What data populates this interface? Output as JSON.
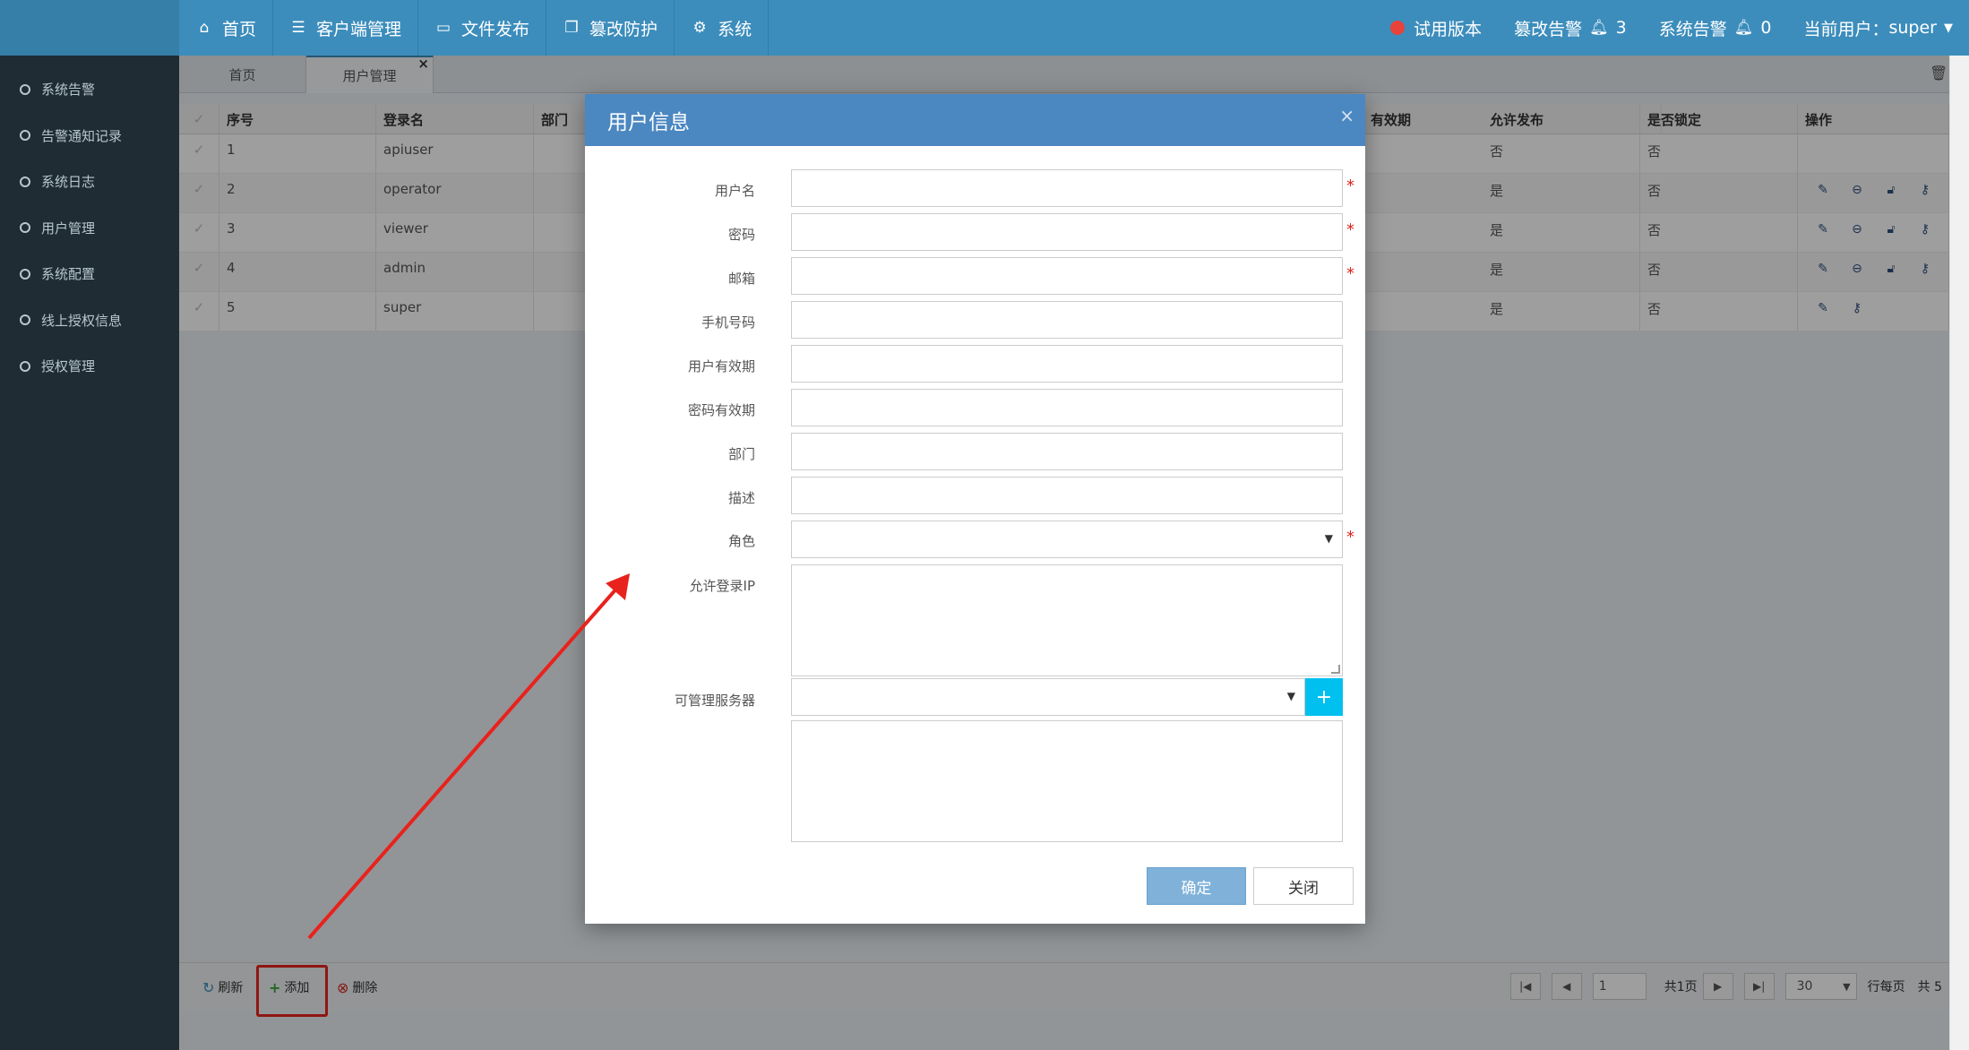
{
  "topbar": {
    "nav": [
      {
        "label": "首页",
        "icon": "home-icon"
      },
      {
        "label": "客户端管理",
        "icon": "server-icon"
      },
      {
        "label": "文件发布",
        "icon": "laptop-icon"
      },
      {
        "label": "篡改防护",
        "icon": "copy-icon"
      },
      {
        "label": "系统",
        "icon": "gears-icon"
      }
    ],
    "trial_label": "试用版本",
    "tamper_alert_label": "篡改告警",
    "tamper_alert_count": "3",
    "system_alert_label": "系统告警",
    "system_alert_count": "0",
    "current_user_label": "当前用户：",
    "current_user": "super"
  },
  "sidebar": {
    "items": [
      {
        "label": "系统告警"
      },
      {
        "label": "告警通知记录"
      },
      {
        "label": "系统日志"
      },
      {
        "label": "用户管理"
      },
      {
        "label": "系统配置"
      },
      {
        "label": "线上授权信息"
      },
      {
        "label": "授权管理"
      }
    ]
  },
  "tabs": [
    {
      "label": "首页"
    },
    {
      "label": "用户管理",
      "close": "×"
    }
  ],
  "grid": {
    "headers": {
      "no": "序号",
      "login": "登录名",
      "dept": "部门",
      "expire": "有效期",
      "publish": "允许发布",
      "locked": "是否锁定",
      "ops": "操作"
    },
    "rows": [
      {
        "no": "1",
        "login": "apiuser",
        "publish": "否",
        "locked": "否"
      },
      {
        "no": "2",
        "login": "operator",
        "publish": "是",
        "locked": "否"
      },
      {
        "no": "3",
        "login": "viewer",
        "publish": "是",
        "locked": "否"
      },
      {
        "no": "4",
        "login": "admin",
        "publish": "是",
        "locked": "否"
      },
      {
        "no": "5",
        "login": "super",
        "publish": "是",
        "locked": "否"
      }
    ]
  },
  "toolbar": {
    "refresh": "刷新",
    "add": "添加",
    "delete": "删除"
  },
  "pager": {
    "page": "1",
    "total_pages": "共1页",
    "per_page": "30",
    "per_page_label": "行每页",
    "total": "共 5"
  },
  "modal": {
    "title": "用户信息",
    "close": "×",
    "fields": {
      "username": "用户名",
      "password": "密码",
      "email": "邮箱",
      "phone": "手机号码",
      "user_expire": "用户有效期",
      "pwd_expire": "密码有效期",
      "dept": "部门",
      "desc": "描述",
      "role": "角色",
      "allowed_ip": "允许登录IP",
      "servers": "可管理服务器"
    },
    "required_mark": "*",
    "plus": "+",
    "ok": "确定",
    "cancel": "关闭"
  },
  "colors": {
    "topbar": "#3c8dbc",
    "sidebar": "#1f2c33",
    "modal_header": "#4b87c1",
    "annotation": "#e8221d"
  }
}
